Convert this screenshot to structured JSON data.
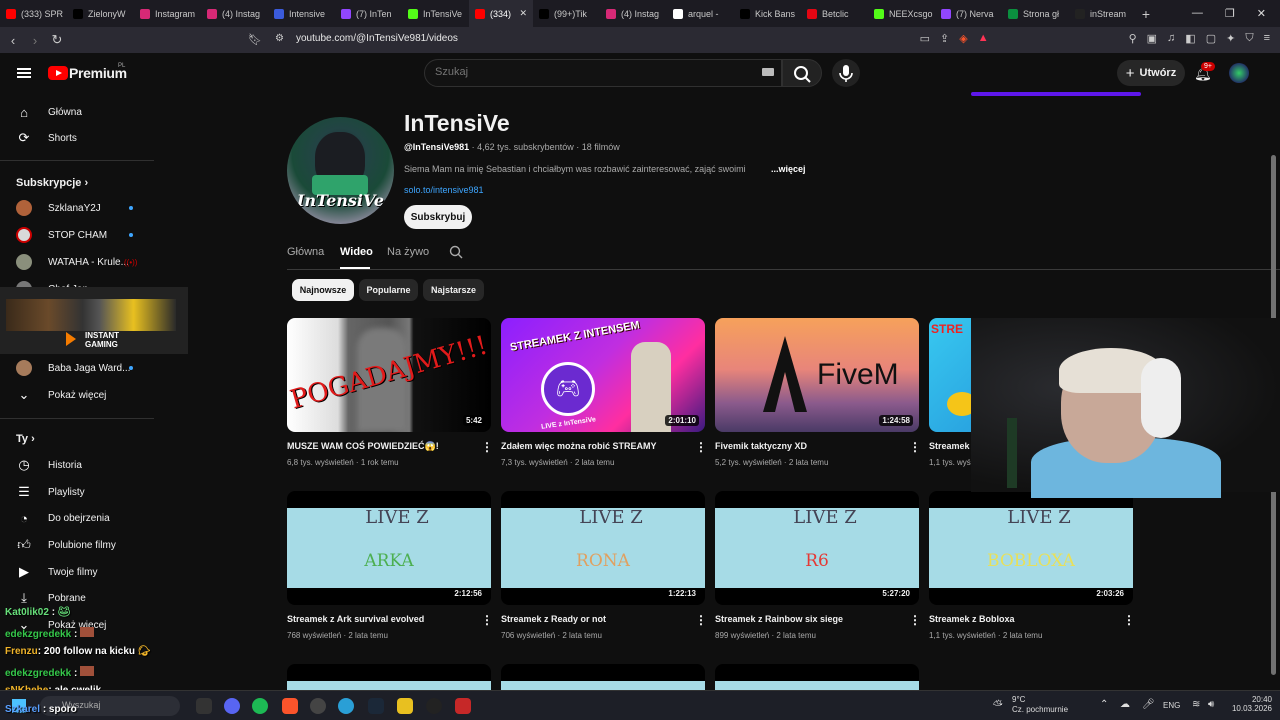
{
  "browser": {
    "tabs": [
      {
        "title": "(333) SPR",
        "color": "#ff0000"
      },
      {
        "title": "ZielonyW",
        "color": "#000000"
      },
      {
        "title": "Instagram",
        "color": "#d62976"
      },
      {
        "title": "(4) Instag",
        "color": "#d62976"
      },
      {
        "title": "Intensive",
        "color": "#3b5bdb"
      },
      {
        "title": "(7) InTen",
        "color": "#9146ff"
      },
      {
        "title": "InTensiVe",
        "color": "#53fc18"
      },
      {
        "title": "(334)",
        "color": "#ff0000",
        "active": true
      },
      {
        "title": "(99+)Tik",
        "color": "#000000"
      },
      {
        "title": "(4) Instag",
        "color": "#d62976"
      },
      {
        "title": "arquel -",
        "color": "#ffffff"
      },
      {
        "title": "Kick Bans",
        "color": "#000000"
      },
      {
        "title": "Betclic",
        "color": "#e30613"
      },
      {
        "title": "NEEXcsgo",
        "color": "#53fc18"
      },
      {
        "title": "(7) Nerva",
        "color": "#9146ff"
      },
      {
        "title": "Strona gł",
        "color": "#0b8f3f"
      },
      {
        "title": "inStream",
        "color": "#222222"
      }
    ],
    "url": "youtube.com/@InTensiVe981/videos"
  },
  "header": {
    "brand": "Premium",
    "region": "PL",
    "search_placeholder": "Szukaj",
    "create_label": "Utwórz",
    "notifications": "9+"
  },
  "sidebar": {
    "main": [
      {
        "label": "Główna",
        "icon": "home-icon"
      },
      {
        "label": "Shorts",
        "icon": "shorts-icon"
      }
    ],
    "subscriptions_title": "Subskrypcje",
    "subscriptions": [
      {
        "label": "SzklanaY2J",
        "color": "#b0623a",
        "live": true
      },
      {
        "label": "STOP CHAM",
        "color": "#d9d9d9",
        "live": true
      },
      {
        "label": "WATAHA - Krule...",
        "color": "#8a8f7c",
        "live": false
      },
      {
        "label": "Chef Jan",
        "color": "#777777",
        "live": false
      },
      {
        "label": "Baba Jaga Ward...",
        "color": "#a67b5b",
        "live": true
      }
    ],
    "show_more": "Pokaż więcej",
    "you_title": "Ty",
    "you": [
      {
        "label": "Historia",
        "icon": "history-icon"
      },
      {
        "label": "Playlisty",
        "icon": "playlist-icon"
      },
      {
        "label": "Do obejrzenia",
        "icon": "watch-later-icon"
      },
      {
        "label": "Polubione filmy",
        "icon": "thumb-up-icon"
      },
      {
        "label": "Twoje filmy",
        "icon": "your-videos-icon"
      },
      {
        "label": "Pobrane",
        "icon": "download-icon"
      },
      {
        "label": "Pokaż więcej",
        "icon": "chevron-down-icon"
      }
    ]
  },
  "channel": {
    "name": "InTensiVe",
    "avatar_text": "InTensiVe",
    "handle": "@InTensiVe981",
    "stats": "· 4,62 tys. subskrybentów · 18 filmów",
    "description": "Siema Mam na imię Sebastian i chciałbym was rozbawić zainteresować, zająć swoimi",
    "more": "...więcej",
    "link": "solo.to/intensive981",
    "subscribe": "Subskrybuj",
    "tabs": [
      {
        "label": "Główna"
      },
      {
        "label": "Wideo",
        "selected": true
      },
      {
        "label": "Na żywo"
      }
    ],
    "chips": [
      {
        "label": "Najnowsze",
        "selected": true
      },
      {
        "label": "Popularne"
      },
      {
        "label": "Najstarsze"
      }
    ]
  },
  "videos": [
    {
      "title": "MUSZE WAM COŚ POWIEDZIEĆ😱!",
      "views": "6,8 tys. wyświetleń",
      "age": "1 rok temu",
      "duration": "5:42",
      "thumb_text": "POGADAJMY!!!"
    },
    {
      "title": "Zdałem więc można robić STREAMY",
      "views": "7,3 tys. wyświetleń",
      "age": "2 lata temu",
      "duration": "2:01:10",
      "thumb_text": "STREAMEK Z INTENSEM",
      "thumb_sub": "LIVE z InTensiVe"
    },
    {
      "title": "Fivemik taktyczny XD",
      "views": "5,2 tys. wyświetleń",
      "age": "2 lata temu",
      "duration": "1:24:58",
      "thumb_text": "FiveM"
    },
    {
      "title": "Streamek",
      "views": "1,1 tys. wyś",
      "age": "",
      "duration": "",
      "thumb_text": "STRE"
    },
    {
      "title": "Streamek z Ark survival evolved",
      "views": "768 wyświetleń",
      "age": "2 lata temu",
      "duration": "2:12:56",
      "thumb_text": "LIVE Z",
      "thumb_sub": "ARKA",
      "sub_color": "#4caf50"
    },
    {
      "title": "Streamek z Ready or not",
      "views": "706 wyświetleń",
      "age": "2 lata temu",
      "duration": "1:22:13",
      "thumb_text": "LIVE Z",
      "thumb_sub": "RONA",
      "sub_color": "#e0a060"
    },
    {
      "title": "Streamek z Rainbow six siege",
      "views": "899 wyświetleń",
      "age": "2 lata temu",
      "duration": "5:27:20",
      "thumb_text": "LIVE Z",
      "thumb_sub": "R6",
      "sub_color": "#e53935"
    },
    {
      "title": "Streamek z Bobloxa",
      "views": "1,1 tys. wyświetleń",
      "age": "2 lata temu",
      "duration": "2:03:26",
      "thumb_text": "LIVE Z",
      "thumb_sub": "BOBLOXA",
      "sub_color": "#e8e05a"
    }
  ],
  "overlay": {
    "instant_gaming": "INSTANT GAMING",
    "chat": [
      {
        "user": "Kat0lik02",
        "msg": ":",
        "color": "#67e07a"
      },
      {
        "user": "edekzgredekk",
        "msg": ":",
        "color": "#35c84a"
      },
      {
        "user": "Frenzu",
        "msg": ": 200 follow na kicku",
        "color": "#f0b429"
      },
      {
        "user": "edekzgredekk",
        "msg": ":",
        "color": "#35c84a"
      },
      {
        "user": "sNKhehe",
        "msg": ": ale cwelik",
        "color": "#f0b429"
      },
      {
        "user": "Szkarel",
        "msg": ": sporo",
        "color": "#5aa0ff"
      }
    ]
  },
  "taskbar": {
    "search": "Wyszukaj",
    "temp": "9°C",
    "weather": "Cz. pochmurnie",
    "lang": "ENG",
    "time": "20:40",
    "date": "10.03.2026"
  }
}
